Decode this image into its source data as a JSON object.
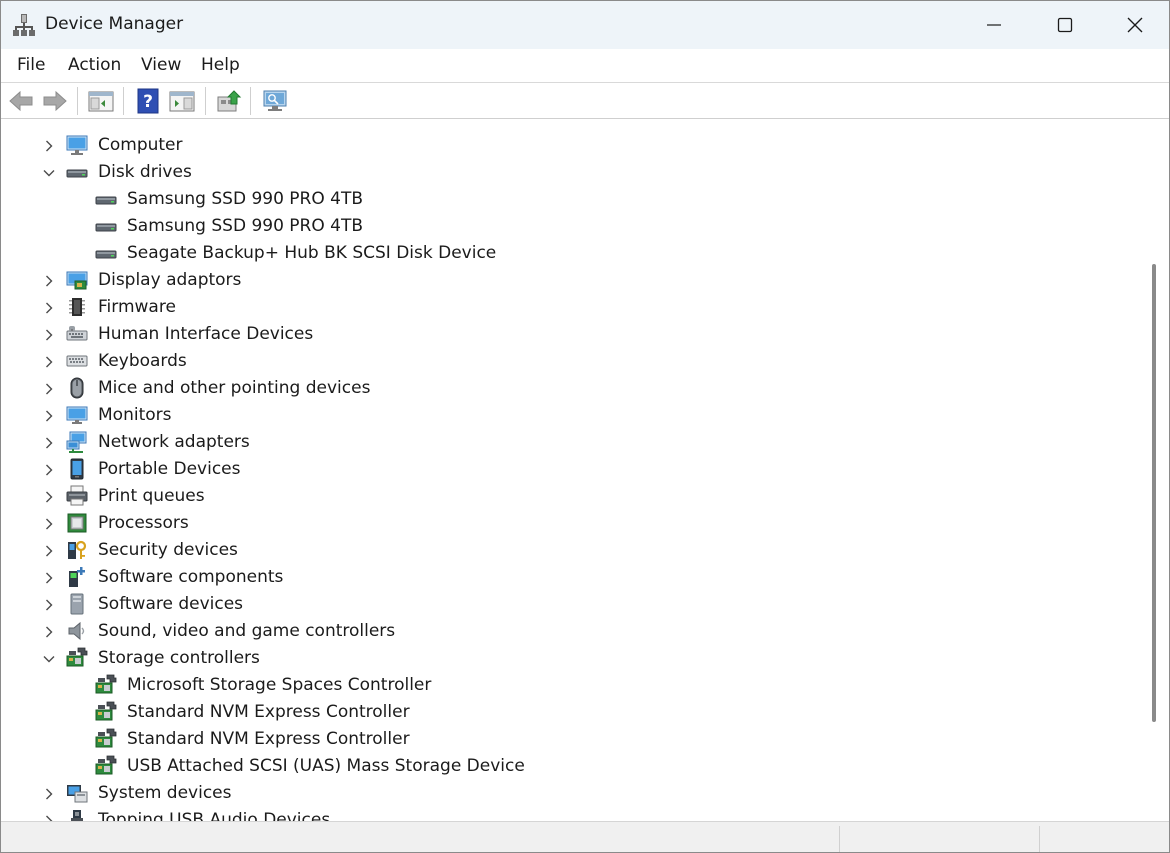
{
  "window": {
    "title": "Device Manager",
    "controls": [
      "minimize-icon",
      "maximize-icon",
      "close-icon"
    ]
  },
  "menu": [
    "File",
    "Action",
    "View",
    "Help"
  ],
  "toolbar": [
    {
      "icon": "back-arrow-icon",
      "enabled": false
    },
    {
      "icon": "forward-arrow-icon",
      "enabled": false
    },
    {
      "icon": "show-hide-console-tree-icon"
    },
    {
      "icon": "help-icon"
    },
    {
      "icon": "show-hide-action-pane-icon"
    },
    {
      "icon": "update-driver-icon"
    },
    {
      "icon": "scan-for-hardware-changes-icon"
    }
  ],
  "tree": [
    {
      "label": "Computer",
      "icon": "computer-icon",
      "state": "collapsed",
      "level": 0
    },
    {
      "label": "Disk drives",
      "icon": "disk-drive-icon",
      "state": "expanded",
      "level": 0
    },
    {
      "label": "Samsung SSD 990 PRO 4TB",
      "icon": "disk-drive-icon",
      "state": "leaf",
      "level": 1
    },
    {
      "label": "Samsung SSD 990 PRO 4TB",
      "icon": "disk-drive-icon",
      "state": "leaf",
      "level": 1
    },
    {
      "label": "Seagate Backup+ Hub BK SCSI Disk Device",
      "icon": "disk-drive-icon",
      "state": "leaf",
      "level": 1
    },
    {
      "label": "Display adaptors",
      "icon": "display-adapter-icon",
      "state": "collapsed",
      "level": 0
    },
    {
      "label": "Firmware",
      "icon": "firmware-chip-icon",
      "state": "collapsed",
      "level": 0
    },
    {
      "label": "Human Interface Devices",
      "icon": "hid-icon",
      "state": "collapsed",
      "level": 0
    },
    {
      "label": "Keyboards",
      "icon": "keyboard-icon",
      "state": "collapsed",
      "level": 0
    },
    {
      "label": "Mice and other pointing devices",
      "icon": "mouse-icon",
      "state": "collapsed",
      "level": 0
    },
    {
      "label": "Monitors",
      "icon": "monitor-icon",
      "state": "collapsed",
      "level": 0
    },
    {
      "label": "Network adapters",
      "icon": "network-adapter-icon",
      "state": "collapsed",
      "level": 0
    },
    {
      "label": "Portable Devices",
      "icon": "portable-device-icon",
      "state": "collapsed",
      "level": 0
    },
    {
      "label": "Print queues",
      "icon": "printer-icon",
      "state": "collapsed",
      "level": 0
    },
    {
      "label": "Processors",
      "icon": "processor-icon",
      "state": "collapsed",
      "level": 0
    },
    {
      "label": "Security devices",
      "icon": "security-device-icon",
      "state": "collapsed",
      "level": 0
    },
    {
      "label": "Software components",
      "icon": "software-component-icon",
      "state": "collapsed",
      "level": 0
    },
    {
      "label": "Software devices",
      "icon": "software-device-icon",
      "state": "collapsed",
      "level": 0
    },
    {
      "label": "Sound, video and game controllers",
      "icon": "speaker-icon",
      "state": "collapsed",
      "level": 0
    },
    {
      "label": "Storage controllers",
      "icon": "storage-controller-icon",
      "state": "expanded",
      "level": 0
    },
    {
      "label": "Microsoft Storage Spaces Controller",
      "icon": "storage-controller-icon",
      "state": "leaf",
      "level": 1
    },
    {
      "label": "Standard NVM Express Controller",
      "icon": "storage-controller-icon",
      "state": "leaf",
      "level": 1
    },
    {
      "label": "Standard NVM Express Controller",
      "icon": "storage-controller-icon",
      "state": "leaf",
      "level": 1
    },
    {
      "label": "USB Attached SCSI (UAS) Mass Storage Device",
      "icon": "storage-controller-icon",
      "state": "leaf",
      "level": 1
    },
    {
      "label": "System devices",
      "icon": "system-device-icon",
      "state": "collapsed",
      "level": 0
    },
    {
      "label": "Topping USB Audio Devices",
      "icon": "usb-audio-icon",
      "state": "collapsed",
      "level": 0
    }
  ]
}
